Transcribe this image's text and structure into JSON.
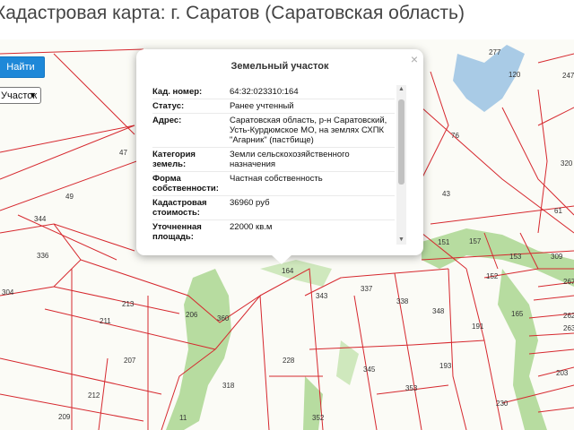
{
  "page": {
    "title": "Кадастровая карта: г. Саратов (Саратовская область)"
  },
  "toolbar": {
    "find_label": "Найти",
    "select_value": "Участок"
  },
  "popup": {
    "title": "Земельный участок",
    "close": "×",
    "rows": [
      {
        "key": "Кад. номер:",
        "value": "64:32:023310:164"
      },
      {
        "key": "Статус:",
        "value": "Ранее учтенный"
      },
      {
        "key": "Адрес:",
        "value": "Саратовская область, р-н Саратовский, Усть-Курдюмское МО, на землях СХПК \"Агарник\" (пастбище)"
      },
      {
        "key": "Категория земель:",
        "value": "Земли сельскохозяйственного назначения"
      },
      {
        "key": "Форма собственности:",
        "value": "Частная собственность"
      },
      {
        "key": "Кадастровая стоимость:",
        "value": "36960 руб"
      },
      {
        "key": "Уточненная площадь:",
        "value": "22000 кв.м"
      }
    ]
  },
  "map_labels": [
    "277",
    "120",
    "247",
    "76",
    "320",
    "47",
    "43",
    "61",
    "49",
    "344",
    "151",
    "157",
    "153",
    "309",
    "336",
    "164",
    "152",
    "304",
    "213",
    "206",
    "360",
    "343",
    "337",
    "338",
    "348",
    "165",
    "267",
    "211",
    "191",
    "262",
    "263",
    "207",
    "228",
    "345",
    "193",
    "203",
    "318",
    "212",
    "353",
    "230",
    "209",
    "352",
    "11"
  ],
  "colors": {
    "boundary": "#d6282e",
    "vegetation": "#b7dca0",
    "water": "#a9cbe6",
    "button": "#1e88d8"
  }
}
